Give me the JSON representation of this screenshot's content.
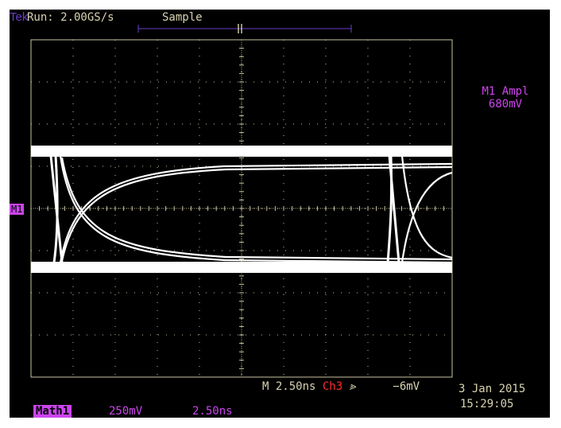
{
  "status": {
    "brand": "Tek",
    "run": "Run: 2.00GS/s",
    "mode": "Sample"
  },
  "measurement": {
    "name": "M1 Ampl",
    "value": "680mV"
  },
  "timebase": {
    "main": "M 2.50ns",
    "trigger_source": "Ch3",
    "trigger_slope_icon": "rising-edge-icon",
    "trigger_level": "−6mV"
  },
  "datetime": {
    "date": "3 Jan 2015",
    "time": "15:29:05"
  },
  "math": {
    "label": "Math1",
    "volts_per_div": "250mV",
    "time_per_div": "2.50ns"
  },
  "ground_marker": "M1",
  "colors": {
    "background": "#000000",
    "graticule": "#c8c4a0",
    "trace": "#ffffff",
    "math": "#cc44ee",
    "channel3": "#ff2a2a",
    "text": "#d8d4b0"
  }
}
